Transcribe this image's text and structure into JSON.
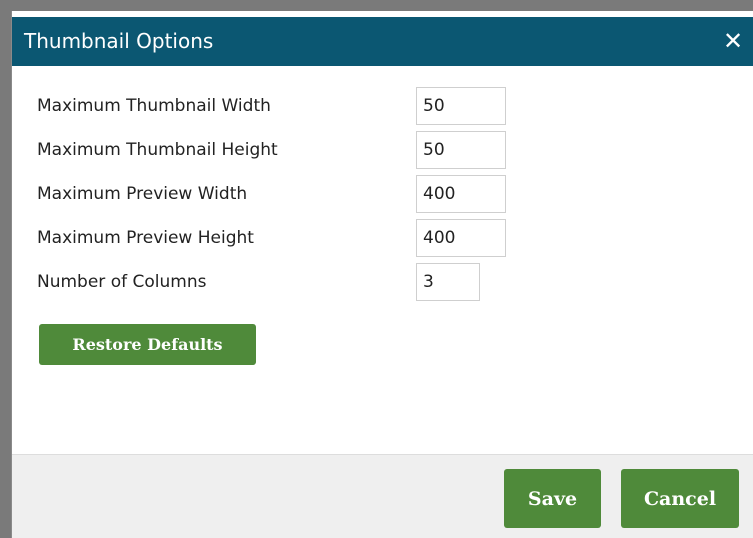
{
  "dialog": {
    "title": "Thumbnail Options",
    "close_glyph": "✕"
  },
  "fields": [
    {
      "label": "Maximum Thumbnail Width",
      "value": "50"
    },
    {
      "label": "Maximum Thumbnail Height",
      "value": "50"
    },
    {
      "label": "Maximum Preview Width",
      "value": "400"
    },
    {
      "label": "Maximum Preview Height",
      "value": "400"
    },
    {
      "label": "Number of Columns",
      "value": "3"
    }
  ],
  "buttons": {
    "restore_label": "Restore Defaults",
    "save_label": "Save",
    "cancel_label": "Cancel"
  },
  "colors": {
    "titlebar": "#0b5772",
    "button_green": "#4f8a3a",
    "footer": "#efefef"
  }
}
